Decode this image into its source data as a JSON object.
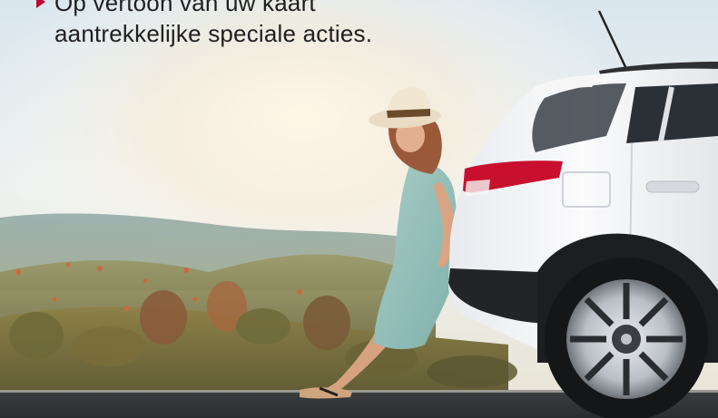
{
  "promo": {
    "line1": "Op vertoon van uw kaart",
    "line2": "aantrekkelijke speciale acties."
  },
  "colors": {
    "bullet": "#c3002f",
    "text": "#1f1f1f",
    "car_body": "#f2f3f5",
    "taillight": "#c8102e"
  },
  "icons": {
    "bullet": "triangle-right-icon"
  }
}
